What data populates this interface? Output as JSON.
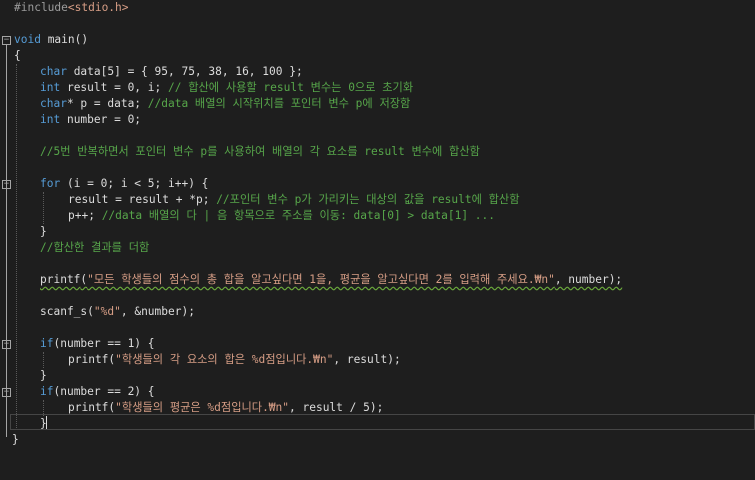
{
  "editor": {
    "lines": {
      "include": {
        "directive": "#include",
        "header": "<stdio.h>"
      },
      "main_sig": {
        "kw": "void",
        "rest": " main()"
      },
      "open_brace": "{",
      "l_data": {
        "kw": "char",
        "rest": " data[5] = { 95, 75, 38, 16, 100 };"
      },
      "l_result": {
        "kw": "int",
        "code": " result = 0, i; ",
        "comment": "// 합산에 사용할 result 변수는 0으로 초기화"
      },
      "l_p": {
        "kw": "char",
        "code": "* p = data; ",
        "comment": "//data 배열의 시작위치를 포인터 변수 p에 저장함"
      },
      "l_number": {
        "kw": "int",
        "rest": " number = 0;"
      },
      "comment_loop": "//5번 반복하면서 포인터 변수 p를 사용하여 배열의 각 요소를 result 변수에 합산함",
      "l_for": {
        "kw": "for",
        "rest": " (i = 0; i < 5; i++) {"
      },
      "l_sum": {
        "code": "result = result + *p; ",
        "comment": "//포인터 변수 p가 가리키는 대상의 값을 result에 합산함"
      },
      "l_inc": {
        "code": "p++; ",
        "comment": "//data 배열의 다 | 음 항목으로 주소를 이동: data[0] > data[1] ..."
      },
      "close_for": "}",
      "comment_sum": "//합산한 결과를 더함",
      "l_printf1": {
        "fn": "printf",
        "open": "(",
        "str": "\"모든 학생들의 점수의 총 합을 알고싶다면 1을, 평균을 알고싶다면 2를 입력해 주세요.₩n\"",
        "rest": ", number);"
      },
      "l_scanf": {
        "fn": "scanf_s",
        "open": "(",
        "str": "\"%d\"",
        "rest": ", &number);"
      },
      "l_if1": {
        "kw": "if",
        "rest": "(number == 1) {"
      },
      "l_print_sum": {
        "fn": "printf",
        "open": "(",
        "str": "\"학생들의 각 요소의 합은 %d점입니다.₩n\"",
        "rest": ", result);"
      },
      "close_if1": "}",
      "l_if2": {
        "kw": "if",
        "rest": "(number == 2) {"
      },
      "l_print_avg": {
        "fn": "printf",
        "open": "(",
        "str": "\"학생들의 평균은 %d점입니다.₩n\"",
        "rest": ", result / 5);"
      },
      "close_if2": "}",
      "close_main": "}"
    }
  },
  "colors": {
    "background": "#1e1e1e",
    "keyword": "#569cd6",
    "comment": "#57a64a",
    "string": "#d69d85",
    "text": "#dcdcdc"
  },
  "icons": [
    "collapse-minus-icon"
  ]
}
